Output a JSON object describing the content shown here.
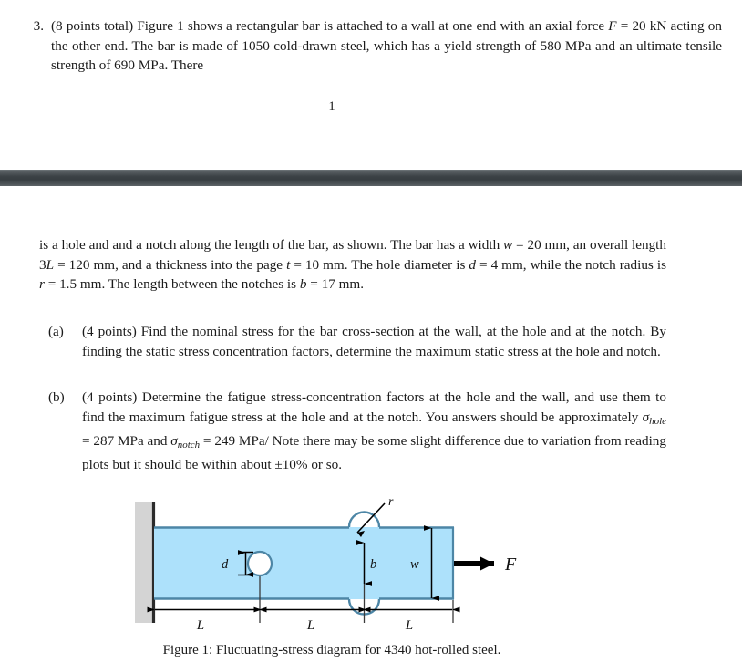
{
  "document": {
    "page_number": "1",
    "problem": {
      "number": "3.",
      "line1_a": "(8 points total) Figure 1 shows a rectangular bar is attached to a wall at one end with an axial force ",
      "var_F": "F",
      "line1_b": " = 20 kN acting on the other end. The bar is made of 1050 cold-drawn steel, which has a yield strength of 580 MPa and an ultimate tensile strength of 690 MPa. There"
    },
    "continued": {
      "seg1": "is a hole and and a notch along the length of the bar, as shown. The bar has a width ",
      "var_w": "w",
      "seg2": " = 20 mm, an overall length 3",
      "var_L": "L",
      "seg3": " = 120 mm, and a thickness into the page ",
      "var_t": "t",
      "seg4": " = 10 mm. The hole diameter is ",
      "var_d": "d",
      "seg5": " = 4 mm, while the notch radius is ",
      "var_r": "r",
      "seg6": " = 1.5 mm. The length between the notches is ",
      "var_b": "b",
      "seg7": " = 17 mm."
    },
    "part_a": {
      "label": "(a)",
      "text": "(4 points) Find the nominal stress for the bar cross-section at the wall, at the hole and at the notch. By finding the static stress concentration factors, determine the maximum static stress at the hole and notch."
    },
    "part_b": {
      "label": "(b)",
      "seg1": "(4 points) Determine the fatigue stress-concentration factors at the hole and the wall, and use them to find the maximum fatigue stress at the hole and at the notch. You answers should be approximately ",
      "sigma": "σ",
      "sub_hole": "hole",
      "seg2": " = 287 MPa and ",
      "sigma2": "σ",
      "sub_notch": "notch",
      "seg3": " = 249 MPa/ Note there may be some slight difference due to variation from reading plots but it should be within about ±10% or so."
    },
    "figure": {
      "caption": "Figure 1: Fluctuating-stress diagram for 4340 hot-rolled steel.",
      "labels": {
        "radius": "r",
        "diameter": "d",
        "between_notches": "b",
        "width": "w",
        "force": "F",
        "length_1": "L",
        "length_2": "L",
        "length_3": "L"
      },
      "colors": {
        "bar_fill": "#ade1fb",
        "bar_stroke": "#4d86a6",
        "wall_fill": "#d4d4d4",
        "wall_edge": "#2a2a2a",
        "dimension_line": "#000000"
      }
    },
    "separator": {
      "color_top": "#6d7478",
      "color_mid": "#383e42",
      "color_bottom": "#5e6569"
    }
  }
}
